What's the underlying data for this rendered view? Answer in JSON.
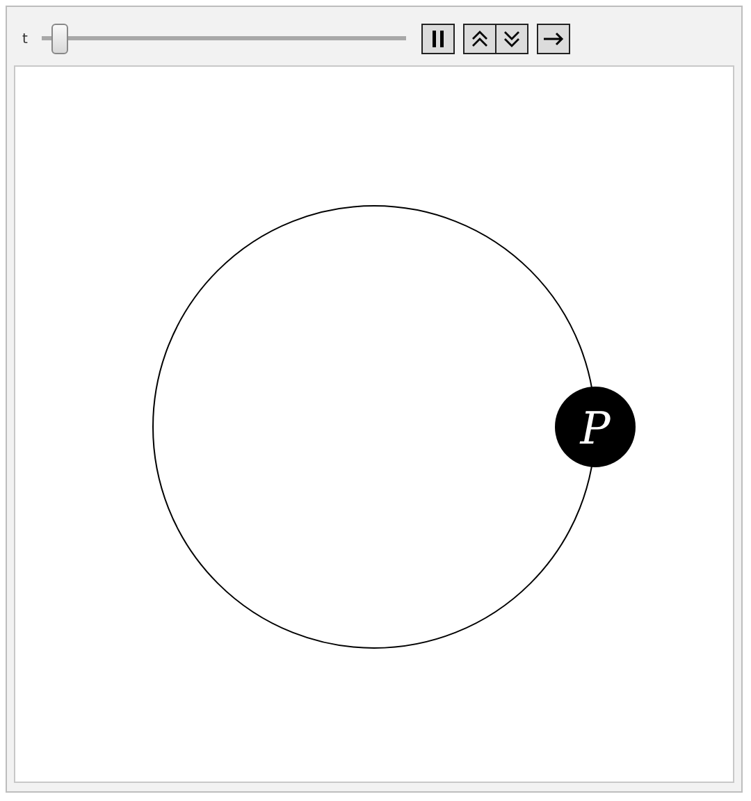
{
  "controls": {
    "slider": {
      "label": "t",
      "level": 0.03
    },
    "buttons": [
      {
        "kind": "pause"
      },
      {
        "kind": "faster"
      },
      {
        "kind": "slower"
      },
      {
        "kind": "direction"
      }
    ]
  },
  "plot": {
    "point": {
      "label": "P"
    }
  }
}
